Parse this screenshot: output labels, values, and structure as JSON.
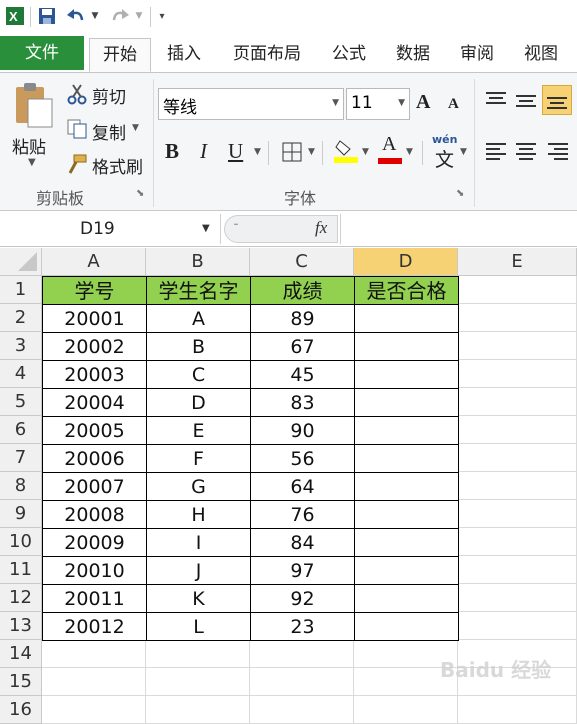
{
  "quick_access": {
    "icons": [
      "excel-logo-icon",
      "save-icon",
      "undo-icon",
      "redo-icon",
      "customize-icon"
    ]
  },
  "tabs": [
    {
      "label": "文件"
    },
    {
      "label": "开始"
    },
    {
      "label": "插入"
    },
    {
      "label": "页面布局"
    },
    {
      "label": "公式"
    },
    {
      "label": "数据"
    },
    {
      "label": "审阅"
    },
    {
      "label": "视图"
    }
  ],
  "ribbon": {
    "clipboard": {
      "paste_label": "粘贴",
      "cut_label": "剪切",
      "copy_label": "复制",
      "format_painter_label": "格式刷",
      "group_label": "剪贴板"
    },
    "font": {
      "font_name": "等线",
      "font_size": "11",
      "bold": "B",
      "italic": "I",
      "underline": "U",
      "font_color_letter": "A",
      "phonetic_label": "wén",
      "phonetic_char": "文",
      "grow_letter": "A",
      "shrink_letter": "A",
      "group_label": "字体"
    }
  },
  "formula_bar": {
    "name_box": "D19",
    "fx": "fx"
  },
  "colors": {
    "header_fill": "#92d050",
    "file_tab": "#2a8f3b",
    "selected_col": "#f6d275"
  },
  "sheet": {
    "columns": [
      "A",
      "B",
      "C",
      "D",
      "E"
    ],
    "row_numbers": [
      "1",
      "2",
      "3",
      "4",
      "5",
      "6",
      "7",
      "8",
      "9",
      "10",
      "11",
      "12",
      "13",
      "14",
      "15",
      "16"
    ],
    "header_row": [
      "学号",
      "学生名字",
      "成绩",
      "是否合格"
    ],
    "rows": [
      [
        "20001",
        "A",
        "89",
        ""
      ],
      [
        "20002",
        "B",
        "67",
        ""
      ],
      [
        "20003",
        "C",
        "45",
        ""
      ],
      [
        "20004",
        "D",
        "83",
        ""
      ],
      [
        "20005",
        "E",
        "90",
        ""
      ],
      [
        "20006",
        "F",
        "56",
        ""
      ],
      [
        "20007",
        "G",
        "64",
        ""
      ],
      [
        "20008",
        "H",
        "76",
        ""
      ],
      [
        "20009",
        "I",
        "84",
        ""
      ],
      [
        "20010",
        "J",
        "97",
        ""
      ],
      [
        "20011",
        "K",
        "92",
        ""
      ],
      [
        "20012",
        "L",
        "23",
        ""
      ]
    ]
  },
  "watermark": "Baidu 经验"
}
